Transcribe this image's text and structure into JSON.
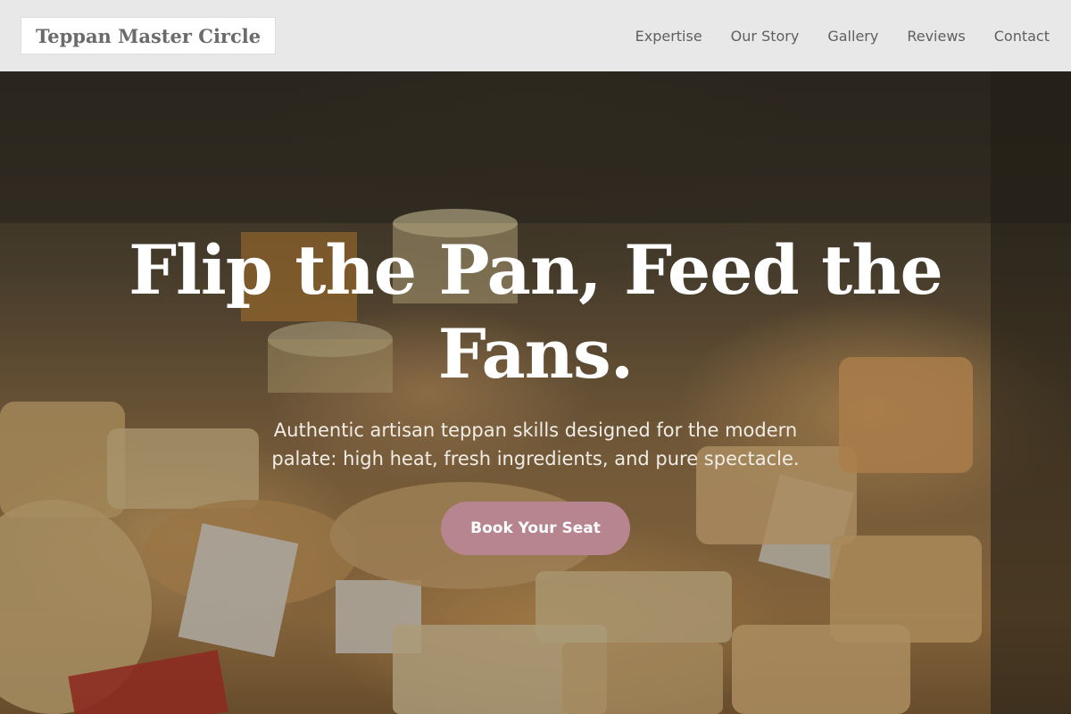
{
  "header": {
    "logo_text": "Teppan Master Circle",
    "nav": [
      {
        "label": "Expertise"
      },
      {
        "label": "Our Story"
      },
      {
        "label": "Gallery"
      },
      {
        "label": "Reviews"
      },
      {
        "label": "Contact"
      }
    ]
  },
  "hero": {
    "title": "Flip the Pan, Feed the Fans.",
    "subtitle": "Authentic artisan teppan skills designed for the modern palate: high heat, fresh ingredients, and pure spectacle.",
    "cta_label": "Book Your Seat",
    "background_image": "cheese-shop-display"
  },
  "colors": {
    "header_background": "#e8e8e8",
    "logo_text": "#6b6b6b",
    "nav_text": "#5f5f5f",
    "hero_text": "#ffffff",
    "cta_background": "#b7858f"
  }
}
